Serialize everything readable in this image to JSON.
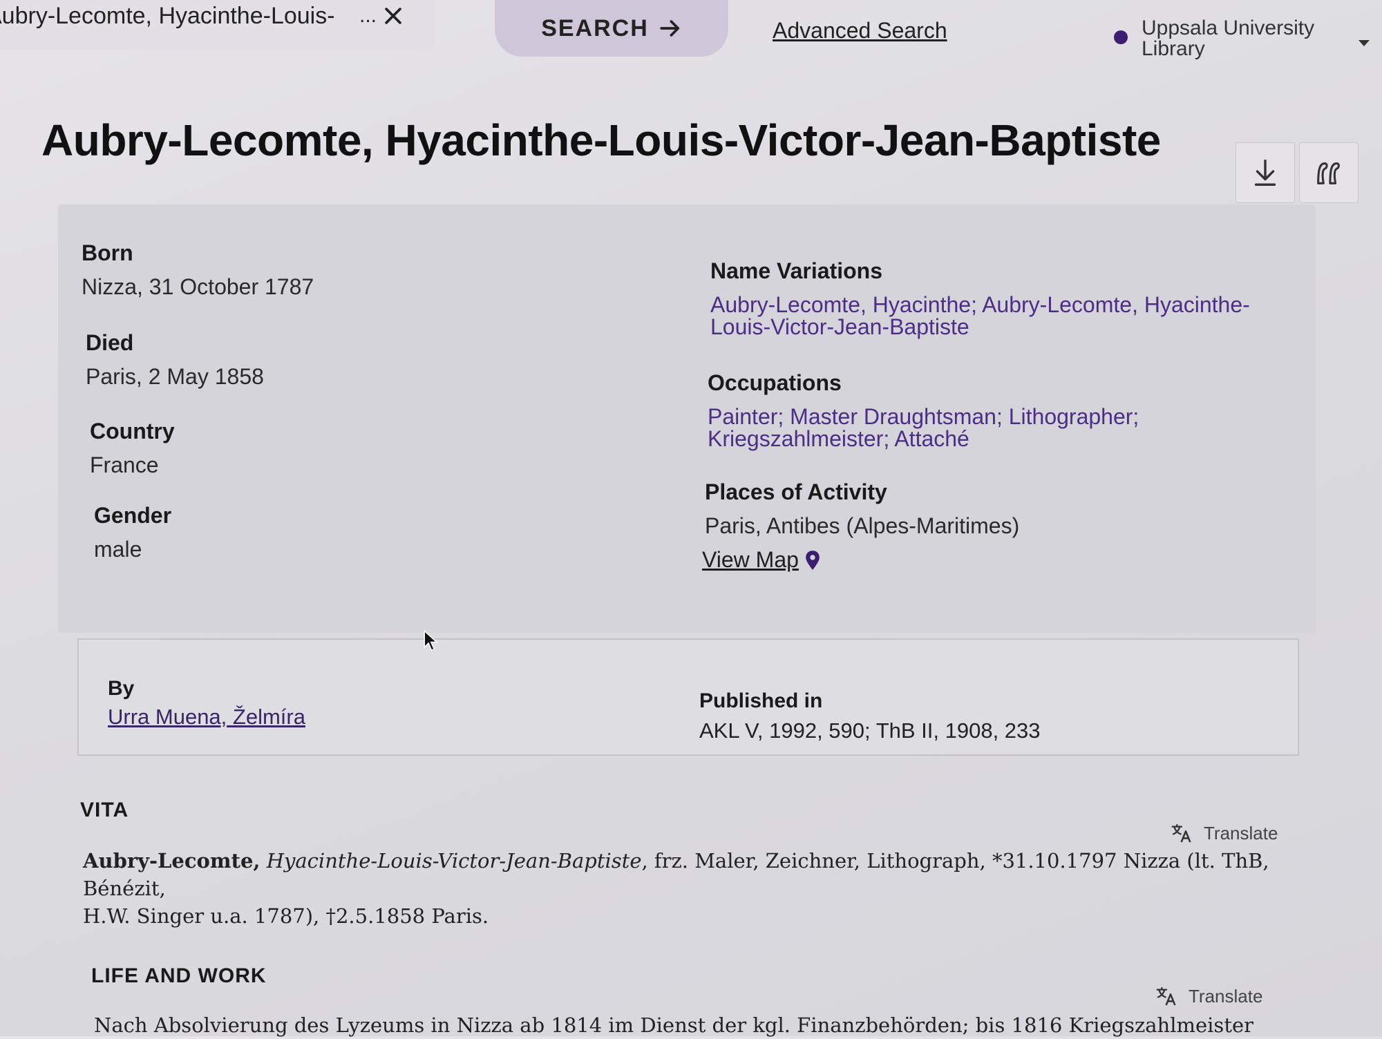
{
  "topbar": {
    "search_value": "Aubry-Lecomte, Hyacinthe-Louis-",
    "search_ellipsis": "...",
    "search_button": "SEARCH",
    "advanced_search": "Advanced Search",
    "library": "Uppsala University Library",
    "library_dot_color": "#3a1e72"
  },
  "page_title": "Aubry-Lecomte, Hyacinthe-Louis-Victor-Jean-Baptiste",
  "actions": {
    "download_icon": "download-icon",
    "cite_icon": "quote-icon"
  },
  "facts": {
    "born": {
      "label": "Born",
      "value": "Nizza, 31 October 1787"
    },
    "died": {
      "label": "Died",
      "value": "Paris, 2 May 1858"
    },
    "country": {
      "label": "Country",
      "value": "France"
    },
    "gender": {
      "label": "Gender",
      "value": "male"
    },
    "name_variations": {
      "label": "Name Variations",
      "line1": "Aubry-Lecomte, Hyacinthe; Aubry-Lecomte, Hyacinthe-",
      "line2": "Louis-Victor-Jean-Baptiste"
    },
    "occupations": {
      "label": "Occupations",
      "line1": "Painter; Master Draughtsman; Lithographer;",
      "line2": "Kriegszahlmeister; Attaché"
    },
    "places": {
      "label": "Places of Activity",
      "value": "Paris, Antibes (Alpes-Maritimes)"
    },
    "view_map": "View Map"
  },
  "author": {
    "by_label": "By",
    "by_value": "Urra Muena, Želmíra",
    "published_label": "Published in",
    "published_value": "AKL V, 1992, 590; ThB II, 1908, 233"
  },
  "vita": {
    "heading": "VITA",
    "translate": "Translate",
    "surname": "Aubry-Lecomte,",
    "given_names": "Hyacinthe-Louis-Victor-Jean-Baptiste",
    "line1_rest": ", frz. Maler, Zeichner, Lithograph, *31.10.1797 Nizza (lt. ThB, Bénézit,",
    "line2": "H.W. Singer u.a. 1787), †2.5.1858 Paris."
  },
  "life_and_work": {
    "heading": "LIFE AND WORK",
    "translate": "Translate",
    "line1": "Nach Absolvierung des Lyzeums in Nizza ab 1814 im Dienst der kgl. Finanzbehörden; bis 1816 Kriegszahlmeister"
  }
}
